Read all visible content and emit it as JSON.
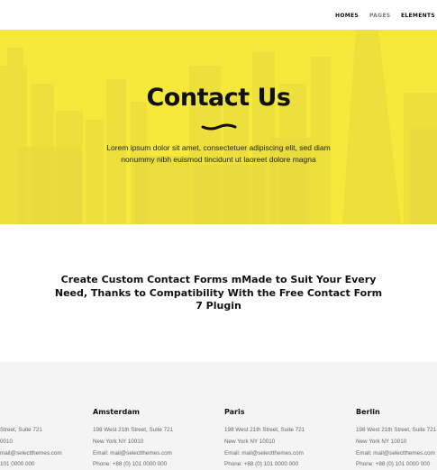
{
  "nav": {
    "items": [
      {
        "label": "HOMES"
      },
      {
        "label": "PAGES"
      },
      {
        "label": "ELEMENTS"
      }
    ]
  },
  "hero": {
    "title": "Contact Us",
    "text": "Lorem ipsum dolor sit amet, consectetuer adipiscing elit, sed diam nonummy nibh euismod tincidunt ut laoreet dolore magna",
    "background_color": "#f7e83c"
  },
  "headline": "Create Custom Contact Forms mMade to Suit Your Every Need, Thanks to Compatibility With the Free Contact Form 7 Plugin",
  "locations": [
    {
      "city": "",
      "lines": [
        "Street, Suite 721",
        "0010",
        "mail@selectthemes.com",
        "101 0000 000"
      ]
    },
    {
      "city": "Amsterdam",
      "lines": [
        "198 West 21th Street, Suite 721",
        "New York NY 10010",
        "Email: mail@selectthemes.com",
        "Phone: +88 (0) 101 0000 000"
      ]
    },
    {
      "city": "Paris",
      "lines": [
        "198 West 21th Street, Suite 721",
        "New York NY 10010",
        "Email: mail@selectthemes.com",
        "Phone: +88 (0) 101 0000 000"
      ]
    },
    {
      "city": "Berlin",
      "lines": [
        "198 West 21th Street, Suite 721",
        "New York NY 10010",
        "Email: mail@selectthemes.com",
        "Phone: +88 (0) 101 0000 000"
      ]
    }
  ]
}
